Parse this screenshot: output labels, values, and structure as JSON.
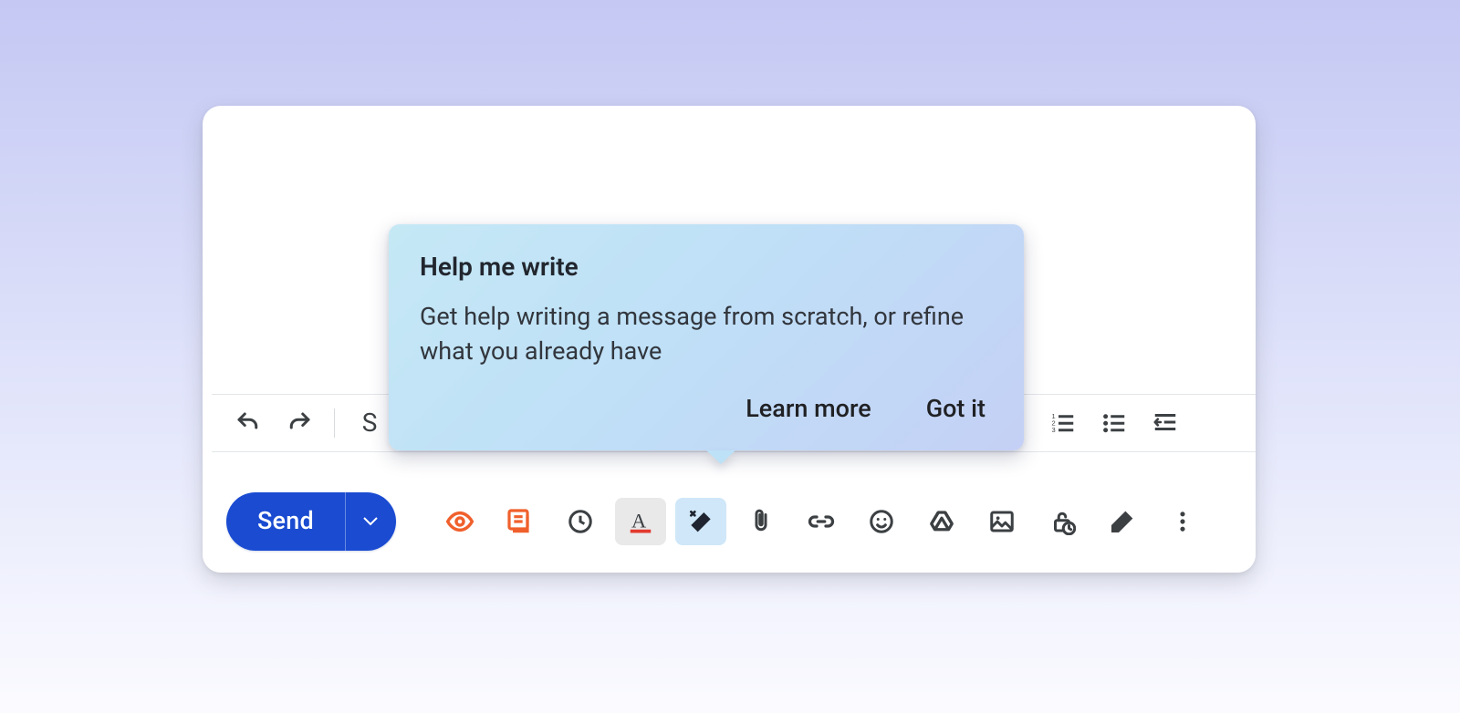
{
  "tooltip": {
    "title": "Help me write",
    "body": "Get help writing a message from scratch, or refine what you already have",
    "learn_more": "Learn more",
    "got_it": "Got it"
  },
  "send": {
    "label": "Send"
  },
  "format_letter": "S"
}
